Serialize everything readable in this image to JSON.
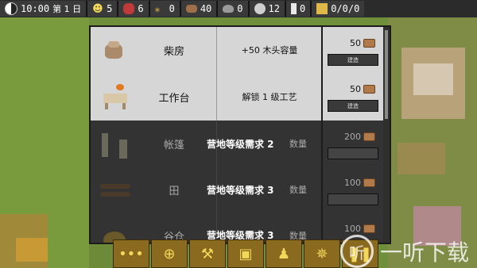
{
  "topbar": {
    "time": "10:00",
    "day": "第 1 日",
    "population": "5",
    "meat": "6",
    "wheat": "0",
    "wood": "40",
    "stone": "0",
    "ore": "12",
    "item": "0",
    "storage": "0/0/0"
  },
  "buildings": [
    {
      "name": "柴房",
      "effect": "+50 木头容量",
      "cost": "50",
      "button": "建造",
      "available": true
    },
    {
      "name": "工作台",
      "effect": "解锁 1 级工艺",
      "cost": "50",
      "button": "建造",
      "available": true
    },
    {
      "name": "帐篷",
      "effect": "数量",
      "cost": "200",
      "button": "",
      "available": false,
      "requirement": "营地等级需求 2"
    },
    {
      "name": "田",
      "effect": "数量",
      "cost": "100",
      "button": "",
      "available": false,
      "requirement": "营地等级需求 3"
    },
    {
      "name": "谷仓",
      "effect": "数量",
      "cost": "100",
      "button": "",
      "available": false,
      "requirement": "营地等级需求 3"
    }
  ],
  "toolbar": [
    "menu-dots-icon",
    "target-icon",
    "anvil-icon",
    "crate-icon",
    "person-icon",
    "network-icon",
    "pause-icon"
  ],
  "watermark": {
    "text": "一听下载"
  },
  "colors": {
    "panel_light": "#d6d6d6",
    "panel_dark": "#333333",
    "toolbar": "#8a6a1e",
    "grass": "#6f8f3b"
  }
}
